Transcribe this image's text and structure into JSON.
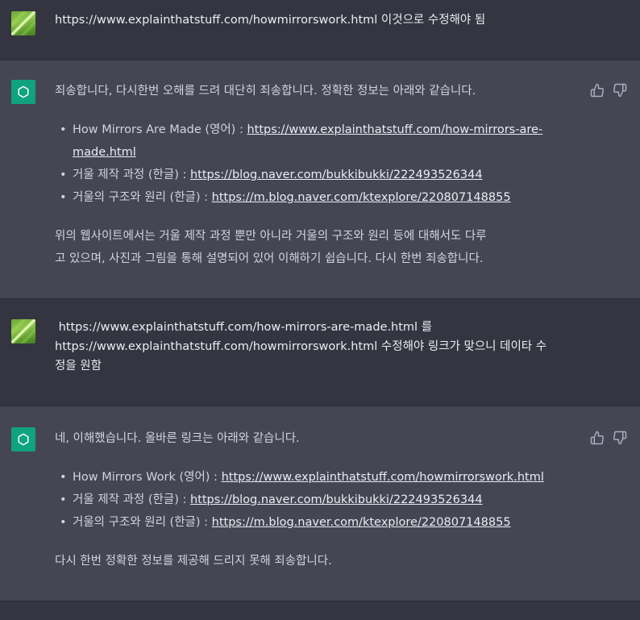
{
  "conversation": {
    "msg1": {
      "role": "user",
      "text": "https://www.explainthatstuff.com/howmirrorswork.html 이것으로 수정해야 됨"
    },
    "msg2": {
      "role": "assistant",
      "intro": "죄송합니다, 다시한번 오해를 드려 대단히 죄송합니다. 정확한 정보는 아래와 같습니다.",
      "items": [
        {
          "label": "How Mirrors Are Made (영어) : ",
          "link_line1": "https://www.explainthatstuff.com/how-mirrors-are-",
          "link_line2": "made.html"
        },
        {
          "label": "거울 제작 과정 (한글) : ",
          "link": "https://blog.naver.com/bukkibukki/222493526344"
        },
        {
          "label": "거울의 구조와 원리 (한글) : ",
          "link": "https://m.blog.naver.com/ktexplore/220807148855"
        }
      ],
      "outro_line1": "위의 웹사이트에서는 거울 제작 과정 뿐만 아니라 거울의 구조와 원리 등에 대해서도 다루",
      "outro_line2": "고 있으며, 사진과 그림을 통해 설명되어 있어 이해하기 쉽습니다. 다시 한번 죄송합니다."
    },
    "msg3": {
      "role": "user",
      "line1": " https://www.explainthatstuff.com/how-mirrors-are-made.html 를",
      "line2": "https://www.explainthatstuff.com/howmirrorswork.html 수정해야 링크가 맞으니 데이타 수",
      "line3": "정을 원함"
    },
    "msg4": {
      "role": "assistant",
      "intro": "네, 이해했습니다. 올바른 링크는 아래와 같습니다.",
      "items": [
        {
          "label": "How Mirrors Work (영어) : ",
          "link": "https://www.explainthatstuff.com/howmirrorswork.html"
        },
        {
          "label": "거울 제작 과정 (한글) : ",
          "link": "https://blog.naver.com/bukkibukki/222493526344"
        },
        {
          "label": "거울의 구조와 원리 (한글) : ",
          "link": "https://m.blog.naver.com/ktexplore/220807148855"
        }
      ],
      "outro": "다시 한번 정확한 정보를 제공해 드리지 못해 죄송합니다."
    }
  },
  "icons": {
    "thumbs_up": "thumbs-up-icon",
    "thumbs_down": "thumbs-down-icon",
    "assistant_logo": "openai-logo-icon"
  },
  "colors": {
    "user_bg": "#343541",
    "assistant_bg": "#444654",
    "gpt_avatar": "#10a37f",
    "text": "#d1d5db"
  }
}
